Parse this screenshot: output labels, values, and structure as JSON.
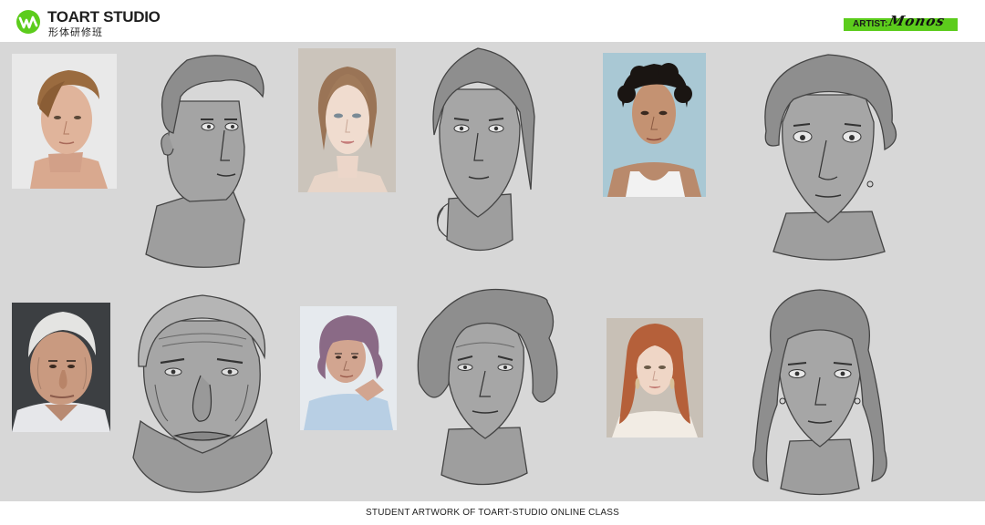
{
  "header": {
    "brand_name": "TOART STUDIO",
    "brand_sub": "形体研修班",
    "artist_label": "ARTIST:",
    "artist_signature": "Monos",
    "accent_color": "#5ccc1c"
  },
  "gallery": {
    "background_color": "#d7d7d7",
    "pairs": [
      {
        "reference": "young man with swept hair",
        "study": "sketch of young man"
      },
      {
        "reference": "young woman with pulled-back hair",
        "study": "sketch of young woman"
      },
      {
        "reference": "man with curly dark hair in tank top",
        "study": "sketch of curly-haired man"
      },
      {
        "reference": "elderly man with white hair",
        "study": "sketch of elderly man"
      },
      {
        "reference": "elderly woman with purple hair",
        "study": "sketch of elderly woman"
      },
      {
        "reference": "young woman with long red hair",
        "study": "sketch of long-haired woman"
      }
    ]
  },
  "footer": {
    "caption": "STUDENT ARTWORK OF TOART-STUDIO ONLINE CLASS"
  }
}
